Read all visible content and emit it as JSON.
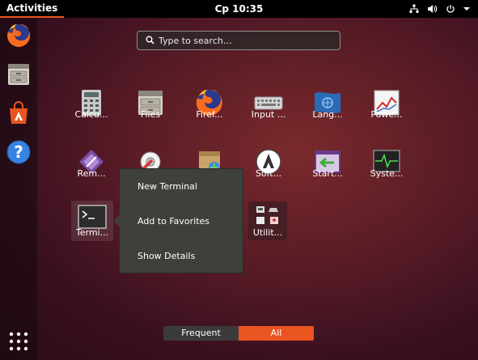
{
  "topbar": {
    "activities": "Activities",
    "clock": "Ср 10:35",
    "icons": [
      "network-icon",
      "volume-icon",
      "power-icon",
      "chevron-down-icon"
    ]
  },
  "dock": {
    "items": [
      "firefox-icon",
      "files-icon",
      "software-icon",
      "help-icon"
    ],
    "show_apps": "show-applications-icon"
  },
  "search": {
    "placeholder": "Type to search…"
  },
  "apps": [
    {
      "label": "Calcu...",
      "icon": "calculator-icon"
    },
    {
      "label": "Files",
      "icon": "files-icon"
    },
    {
      "label": "Firef...",
      "icon": "firefox-icon"
    },
    {
      "label": "Input ...",
      "icon": "keyboard-icon"
    },
    {
      "label": "Lang...",
      "icon": "language-icon"
    },
    {
      "label": "Powe...",
      "icon": "power-statistics-icon"
    },
    {
      "label": "Rem...",
      "icon": "remmina-icon"
    },
    {
      "label": "Soft...",
      "icon": "software-updater-icon"
    },
    {
      "label": "Start...",
      "icon": "startup-apps-icon"
    },
    {
      "label": "Syste...",
      "icon": "system-monitor-icon"
    },
    {
      "label": "Termi...",
      "icon": "terminal-icon"
    },
    {
      "label": "Utilit...",
      "icon": "utilities-folder-icon"
    }
  ],
  "context_menu": {
    "items": [
      "New Terminal",
      "Add to Favorites",
      "Show Details"
    ]
  },
  "view_switch": {
    "frequent": "Frequent",
    "all": "All",
    "active": "All"
  },
  "colors": {
    "accent": "#e95420",
    "menu_bg": "#3f3f3c",
    "topbar": "#000000"
  }
}
